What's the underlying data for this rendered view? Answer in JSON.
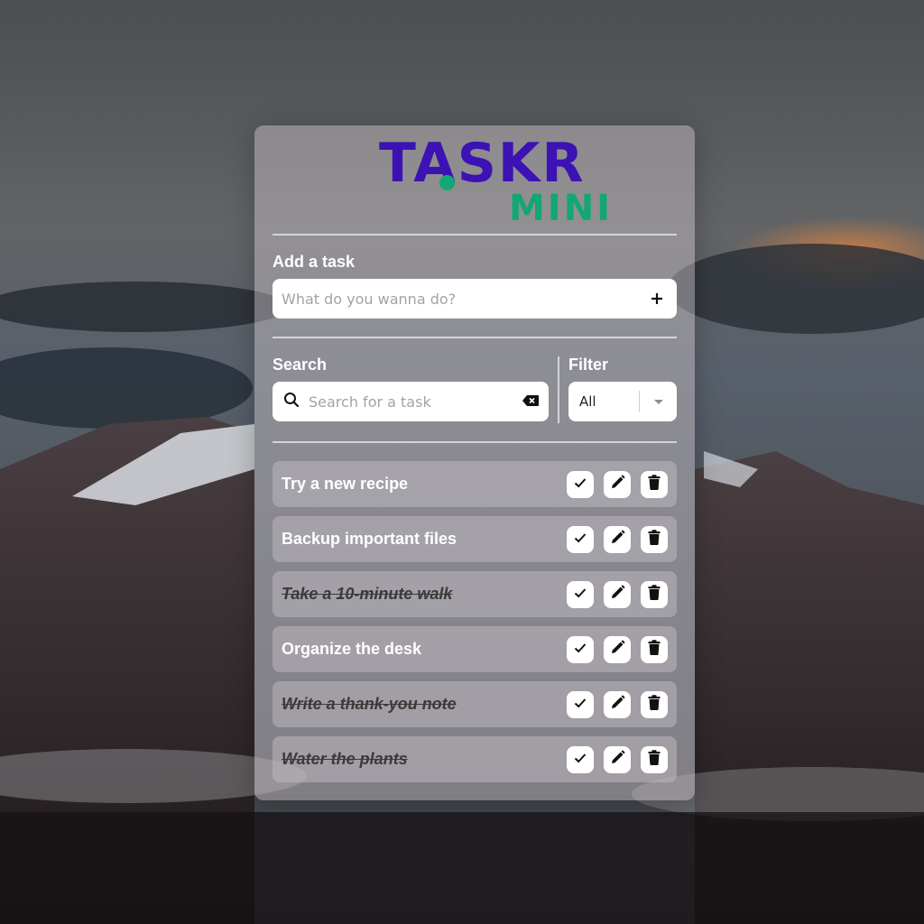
{
  "app": {
    "logo_main": "TASKR",
    "logo_sub": "MINI"
  },
  "add": {
    "label": "Add a task",
    "placeholder": "What do you wanna do?",
    "value": ""
  },
  "search": {
    "label": "Search",
    "placeholder": "Search for a task",
    "value": ""
  },
  "filter": {
    "label": "Filter",
    "selected": "All"
  },
  "tasks": [
    {
      "text": "Try a new recipe",
      "done": false
    },
    {
      "text": "Backup important files",
      "done": false
    },
    {
      "text": "Take a 10-minute walk",
      "done": true
    },
    {
      "text": "Organize the desk",
      "done": false
    },
    {
      "text": "Write a thank-you note",
      "done": true
    },
    {
      "text": "Water the plants",
      "done": true
    }
  ],
  "icons": {
    "add": "plus-icon",
    "search": "search-icon",
    "clear": "backspace-icon",
    "dropdown": "chevron-down-icon",
    "complete": "check-icon",
    "edit": "pencil-icon",
    "delete": "trash-icon"
  },
  "colors": {
    "logo_main": "#3c12b5",
    "logo_accent": "#12a774",
    "task_bg": "rgba(190,182,190,0.55)"
  }
}
